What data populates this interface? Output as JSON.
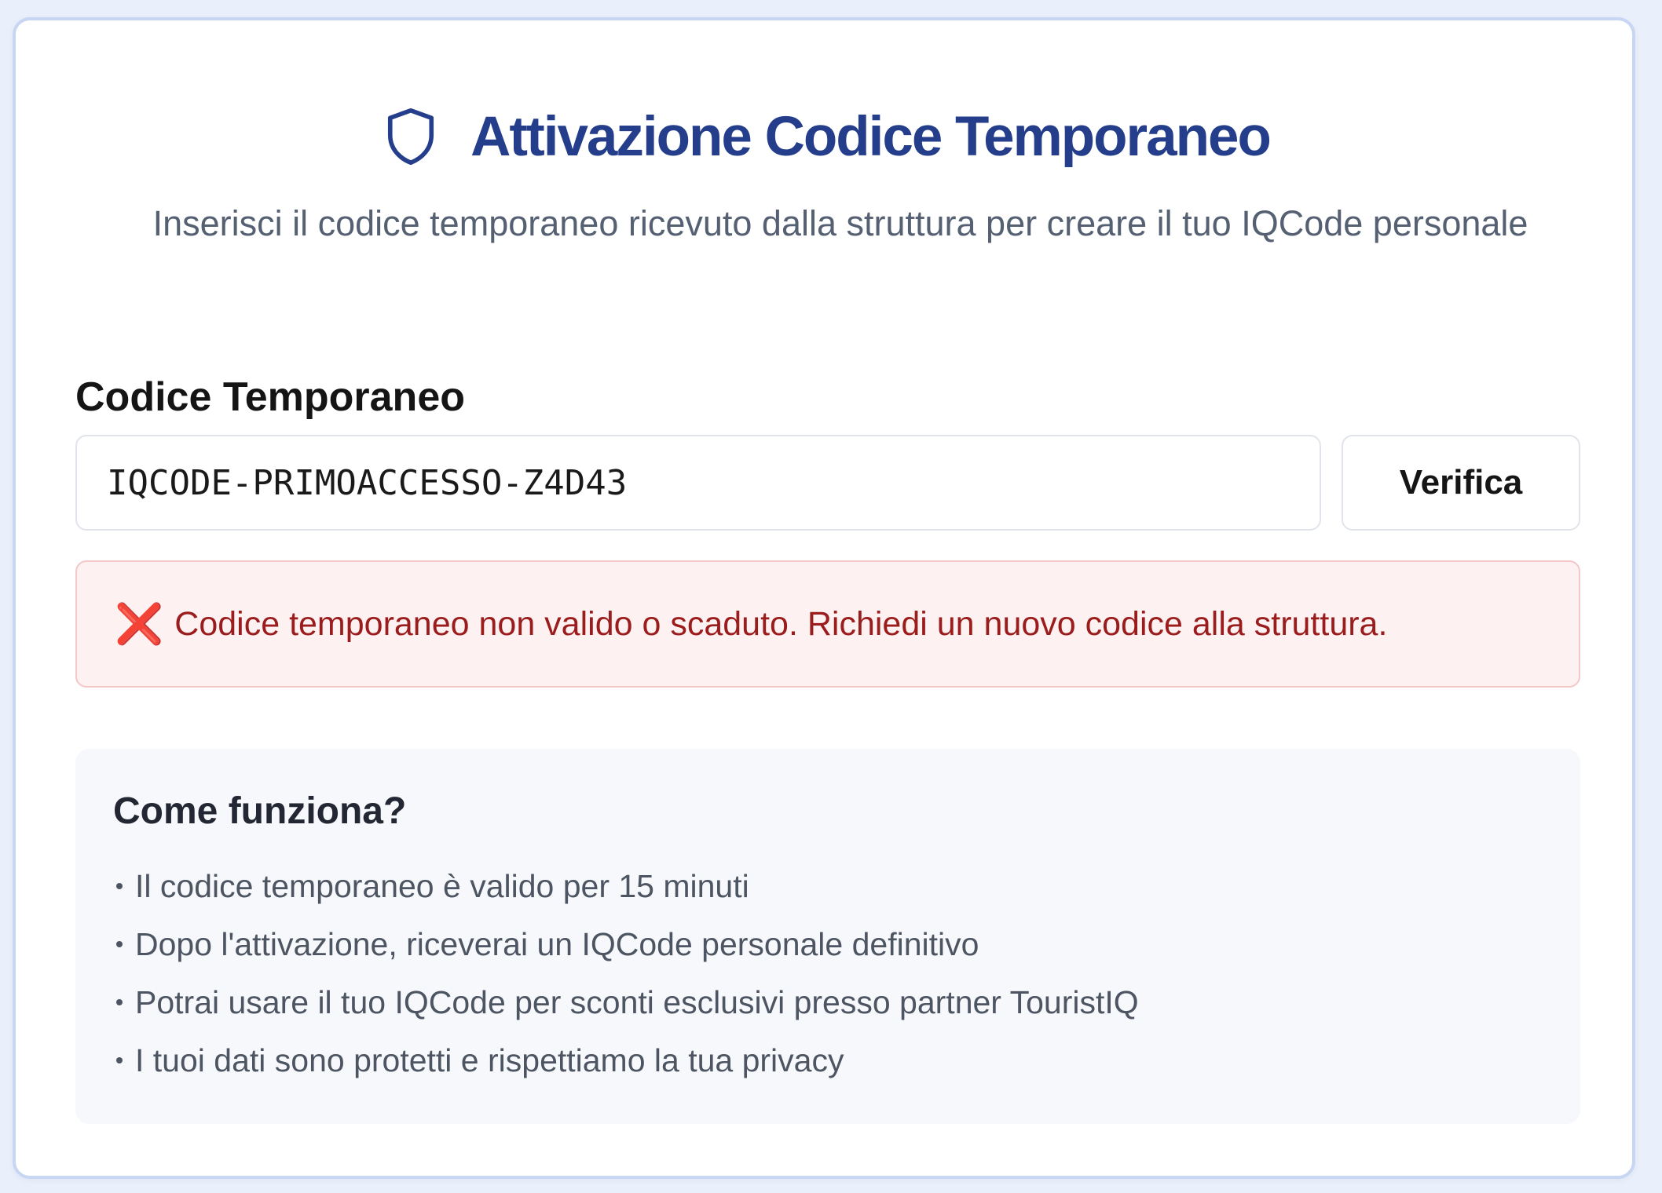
{
  "header": {
    "title": "Attivazione Codice Temporaneo",
    "subtitle": "Inserisci il codice temporaneo ricevuto dalla struttura per creare il tuo IQCode personale",
    "icon": "shield-icon"
  },
  "form": {
    "label": "Codice Temporaneo",
    "input_value": "IQCODE-PRIMOACCESSO-Z4D43",
    "verify_label": "Verifica"
  },
  "error": {
    "icon": "❌",
    "message": "Codice temporaneo non valido o scaduto. Richiedi un nuovo codice alla struttura."
  },
  "info": {
    "title": "Come funziona?",
    "items": [
      "Il codice temporaneo è valido per 15 minuti",
      "Dopo l'attivazione, riceverai un IQCode personale definitivo",
      "Potrai usare il tuo IQCode per sconti esclusivi presso partner TouristIQ",
      "I tuoi dati sono protetti e rispettiamo la tua privacy"
    ]
  },
  "colors": {
    "accent": "#243e8b",
    "error_text": "#9b1c1c",
    "error_bg": "#fdf1f1",
    "info_bg": "#f6f8fb"
  }
}
